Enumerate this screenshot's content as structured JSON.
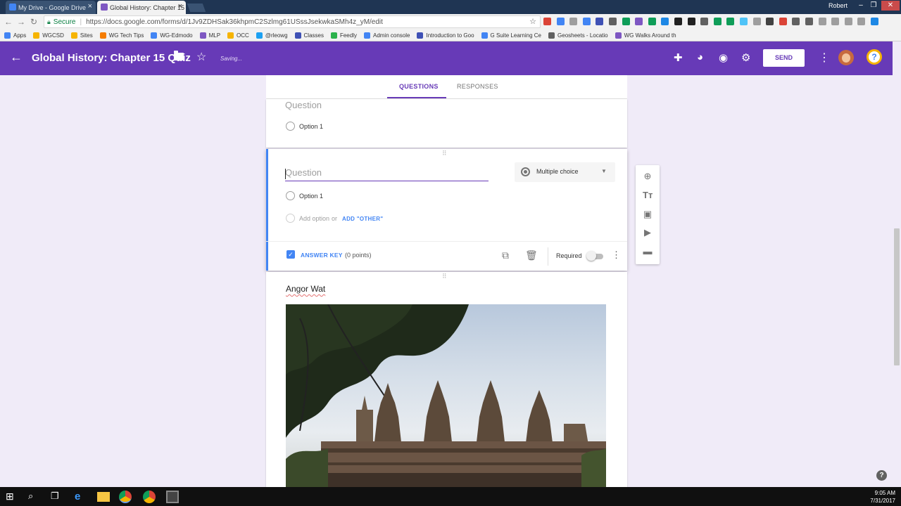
{
  "browser": {
    "tabs": [
      {
        "label": "My Drive - Google Drive",
        "color": "#4285f4"
      },
      {
        "label": "Global History: Chapter 15",
        "color": "#7e57c2"
      }
    ],
    "profile": "Robert",
    "address": {
      "secure_label": "Secure",
      "url": "https://docs.google.com/forms/d/1Jv9ZDHSak36khpmC2Szlmg61USssJsekwkaSMh4z_yM/edit"
    },
    "bookmarks": [
      {
        "label": "Apps",
        "color": "#4285f4"
      },
      {
        "label": "WGCSD",
        "color": "#f6b400"
      },
      {
        "label": "Sites",
        "color": "#f6b400"
      },
      {
        "label": "WG Tech Tips",
        "color": "#f57c00"
      },
      {
        "label": "WG-Edmodo",
        "color": "#4285f4"
      },
      {
        "label": "MLP",
        "color": "#7e57c2"
      },
      {
        "label": "OCC",
        "color": "#f6b400"
      },
      {
        "label": "@rleowg",
        "color": "#1da1f2"
      },
      {
        "label": "Classes",
        "color": "#3f51b5"
      },
      {
        "label": "Feedly",
        "color": "#2bb24c"
      },
      {
        "label": "Admin console",
        "color": "#4285f4"
      },
      {
        "label": "Introduction to Goo",
        "color": "#3f51b5"
      },
      {
        "label": "G Suite Learning Ce",
        "color": "#4285f4"
      },
      {
        "label": "Geosheets - Locatio",
        "color": "#616161"
      },
      {
        "label": "WG Walks Around th",
        "color": "#7e57c2"
      }
    ]
  },
  "form": {
    "title": "Global History: Chapter 15 Quiz",
    "saving": "Saving...",
    "send": "SEND",
    "accent": "#673ab7",
    "tabs": {
      "questions": "QUESTIONS",
      "responses": "RESPONSES"
    },
    "card1": {
      "question": "Question",
      "option": "Option 1"
    },
    "card2": {
      "question_placeholder": "Question",
      "type": "Multiple choice",
      "option": "Option 1",
      "add_option": "Add option",
      "or": "or",
      "add_other": "ADD \"OTHER\"",
      "answer_key": "ANSWER KEY",
      "points": "(0 points)",
      "required": "Required"
    },
    "card3": {
      "title": "Angor Wat"
    }
  },
  "taskbar": {
    "time": "9:05 AM",
    "date": "7/31/2017"
  }
}
